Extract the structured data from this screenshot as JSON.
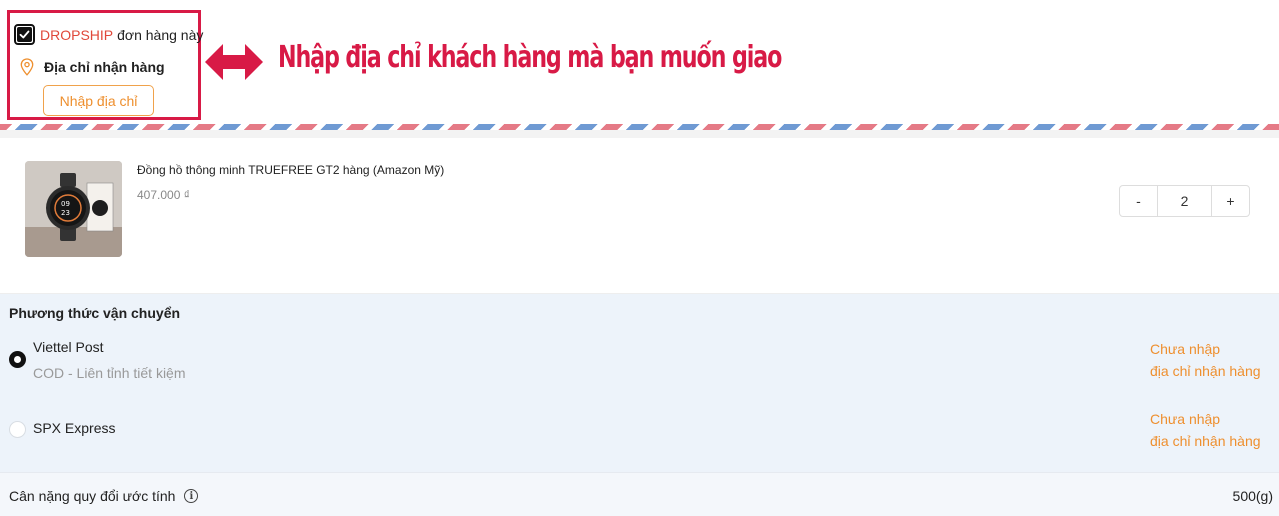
{
  "header": {
    "dropship_word": "DROPSHIP",
    "dropship_rest": "đơn hàng này",
    "dropship_checked": true,
    "address_label": "Địa chỉ nhận hàng",
    "address_button": "Nhập địa chỉ",
    "annotation": "Nhập địa chỉ khách hàng mà bạn muốn giao"
  },
  "product": {
    "name": "Đồng hồ thông minh TRUEFREE GT2 hàng (Amazon Mỹ)",
    "price": "407.000 ₫",
    "quantity": "2",
    "minus": "-",
    "plus": "+"
  },
  "shipping": {
    "title": "Phương thức vận chuyển",
    "carriers": [
      {
        "name": "Viettel Post",
        "detail": "COD - Liên tỉnh tiết kiệm",
        "selected": true,
        "note_line1": "Chưa nhập",
        "note_line2": "địa chỉ nhận hàng"
      },
      {
        "name": "SPX Express",
        "selected": false,
        "note_line1": "Chưa nhập",
        "note_line2": "địa chỉ nhận hàng"
      }
    ]
  },
  "weight": {
    "label": "Cân nặng quy đổi ước tính",
    "value": "500(g)"
  },
  "colors": {
    "accent": "#ee8f2e",
    "annotation": "#d81a46",
    "dropship": "#e0483a"
  }
}
